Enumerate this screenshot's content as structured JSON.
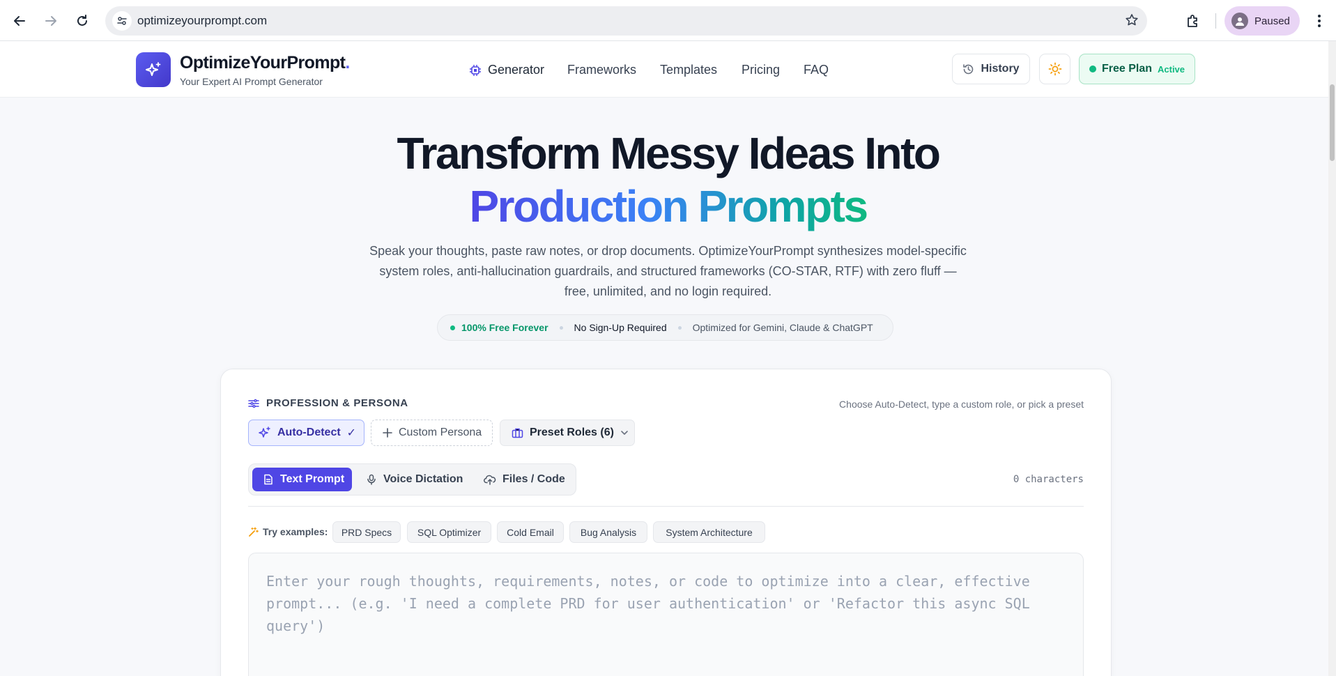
{
  "browser": {
    "url": "optimizeyourprompt.com",
    "profile_label": "Paused"
  },
  "header": {
    "brand": "OptimizeYourPrompt",
    "brand_suffix": ".",
    "tagline": "Your Expert AI Prompt Generator",
    "nav": [
      "Generator",
      "Frameworks",
      "Templates",
      "Pricing",
      "FAQ"
    ],
    "history_label": "History",
    "plan_label": "Free Plan",
    "plan_status": "Active"
  },
  "hero": {
    "line1": "Transform Messy Ideas Into",
    "line2": "Production Prompts",
    "description": "Speak your thoughts, paste raw notes, or drop documents. OptimizeYourPrompt synthesizes model-specific system roles, anti-hallucination guardrails, and structured frameworks (CO-STAR, RTF) with zero fluff — free, unlimited, and no login required.",
    "badges": [
      "100% Free Forever",
      "No Sign-Up Required",
      "Optimized for Gemini, Claude & ChatGPT"
    ]
  },
  "persona": {
    "title": "PROFESSION & PERSONA",
    "hint": "Choose Auto-Detect, type a custom role, or pick a preset",
    "auto_label": "Auto-Detect",
    "auto_check": "✓",
    "custom_label": "Custom Persona",
    "preset_label": "Preset Roles (6)"
  },
  "input_modes": {
    "tabs": [
      "Text Prompt",
      "Voice Dictation",
      "Files / Code"
    ],
    "active": "Text Prompt",
    "char_count": "0 characters"
  },
  "examples": {
    "label": "Try examples:",
    "chips": [
      "PRD Specs",
      "SQL Optimizer",
      "Cold Email",
      "Bug Analysis",
      "System Architecture"
    ]
  },
  "prompt": {
    "value": "",
    "placeholder": "Enter your rough thoughts, requirements, notes, or code to optimize into a clear, effective prompt... (e.g. 'I need a complete PRD for user authentication' or 'Refactor this async SQL query')"
  },
  "colors": {
    "accent": "#4f46e5",
    "success": "#10b981",
    "text": "#111827"
  }
}
